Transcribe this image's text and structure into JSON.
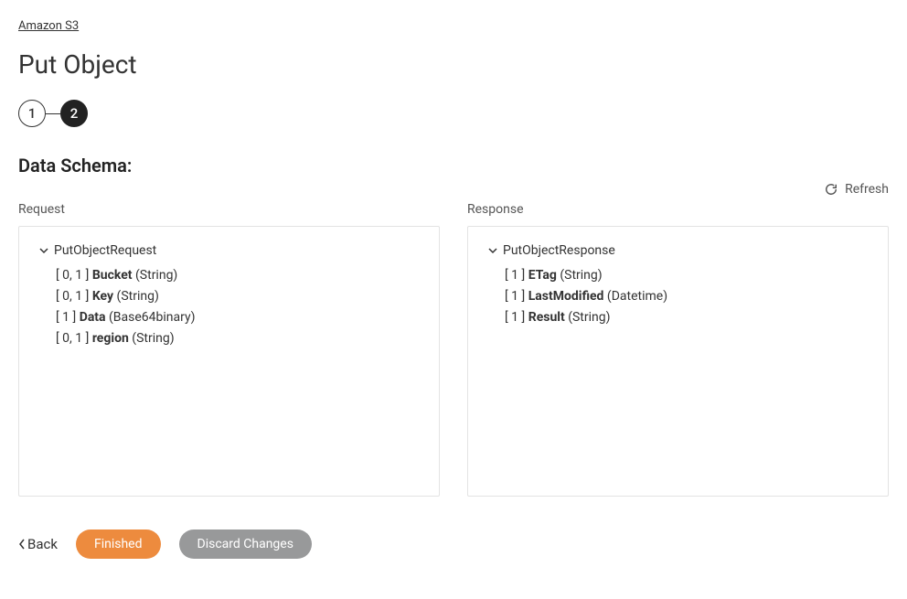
{
  "breadcrumb": "Amazon S3",
  "page_title": "Put Object",
  "stepper": {
    "step1": "1",
    "step2": "2"
  },
  "section_title": "Data Schema:",
  "refresh_label": "Refresh",
  "columns": {
    "request": {
      "label": "Request",
      "root": "PutObjectRequest",
      "fields": [
        {
          "cardinality": "[ 0, 1 ]",
          "name": "Bucket",
          "type": "(String)"
        },
        {
          "cardinality": "[ 0, 1 ]",
          "name": "Key",
          "type": "(String)"
        },
        {
          "cardinality": "[ 1 ]",
          "name": "Data",
          "type": "(Base64binary)"
        },
        {
          "cardinality": "[ 0, 1 ]",
          "name": "region",
          "type": "(String)"
        }
      ]
    },
    "response": {
      "label": "Response",
      "root": "PutObjectResponse",
      "fields": [
        {
          "cardinality": "[ 1 ]",
          "name": "ETag",
          "type": "(String)"
        },
        {
          "cardinality": "[ 1 ]",
          "name": "LastModified",
          "type": "(Datetime)"
        },
        {
          "cardinality": "[ 1 ]",
          "name": "Result",
          "type": "(String)"
        }
      ]
    }
  },
  "buttons": {
    "back": "Back",
    "finished": "Finished",
    "discard": "Discard Changes"
  }
}
